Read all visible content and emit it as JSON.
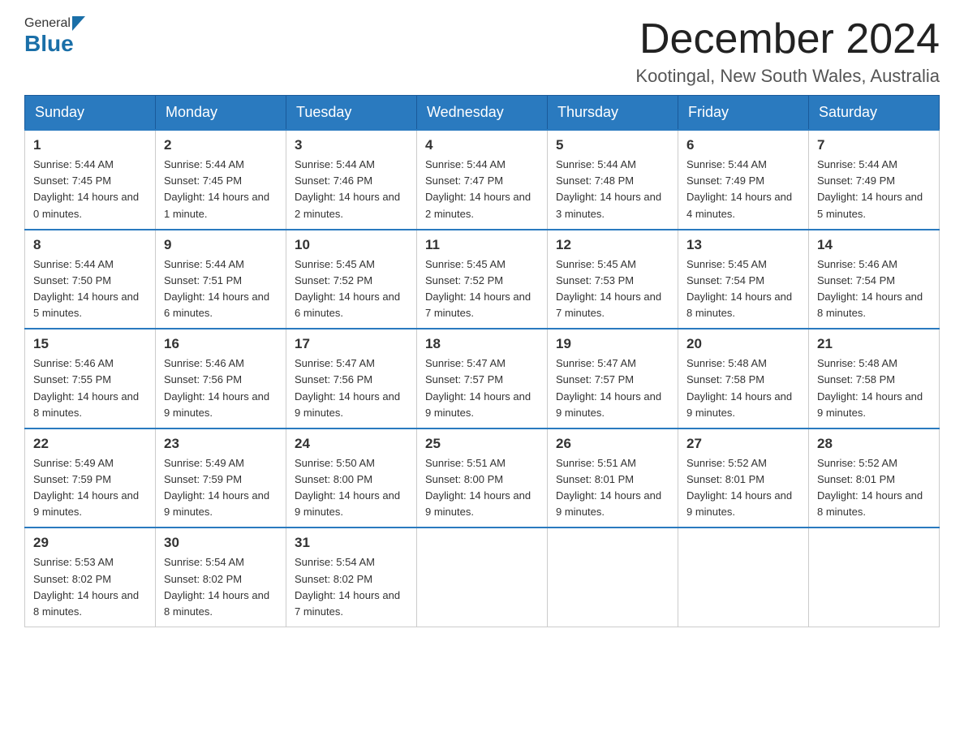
{
  "logo": {
    "general": "General",
    "blue": "Blue"
  },
  "title": "December 2024",
  "location": "Kootingal, New South Wales, Australia",
  "days_of_week": [
    "Sunday",
    "Monday",
    "Tuesday",
    "Wednesday",
    "Thursday",
    "Friday",
    "Saturday"
  ],
  "weeks": [
    [
      {
        "day": 1,
        "sunrise": "5:44 AM",
        "sunset": "7:45 PM",
        "daylight": "14 hours and 0 minutes."
      },
      {
        "day": 2,
        "sunrise": "5:44 AM",
        "sunset": "7:45 PM",
        "daylight": "14 hours and 1 minute."
      },
      {
        "day": 3,
        "sunrise": "5:44 AM",
        "sunset": "7:46 PM",
        "daylight": "14 hours and 2 minutes."
      },
      {
        "day": 4,
        "sunrise": "5:44 AM",
        "sunset": "7:47 PM",
        "daylight": "14 hours and 2 minutes."
      },
      {
        "day": 5,
        "sunrise": "5:44 AM",
        "sunset": "7:48 PM",
        "daylight": "14 hours and 3 minutes."
      },
      {
        "day": 6,
        "sunrise": "5:44 AM",
        "sunset": "7:49 PM",
        "daylight": "14 hours and 4 minutes."
      },
      {
        "day": 7,
        "sunrise": "5:44 AM",
        "sunset": "7:49 PM",
        "daylight": "14 hours and 5 minutes."
      }
    ],
    [
      {
        "day": 8,
        "sunrise": "5:44 AM",
        "sunset": "7:50 PM",
        "daylight": "14 hours and 5 minutes."
      },
      {
        "day": 9,
        "sunrise": "5:44 AM",
        "sunset": "7:51 PM",
        "daylight": "14 hours and 6 minutes."
      },
      {
        "day": 10,
        "sunrise": "5:45 AM",
        "sunset": "7:52 PM",
        "daylight": "14 hours and 6 minutes."
      },
      {
        "day": 11,
        "sunrise": "5:45 AM",
        "sunset": "7:52 PM",
        "daylight": "14 hours and 7 minutes."
      },
      {
        "day": 12,
        "sunrise": "5:45 AM",
        "sunset": "7:53 PM",
        "daylight": "14 hours and 7 minutes."
      },
      {
        "day": 13,
        "sunrise": "5:45 AM",
        "sunset": "7:54 PM",
        "daylight": "14 hours and 8 minutes."
      },
      {
        "day": 14,
        "sunrise": "5:46 AM",
        "sunset": "7:54 PM",
        "daylight": "14 hours and 8 minutes."
      }
    ],
    [
      {
        "day": 15,
        "sunrise": "5:46 AM",
        "sunset": "7:55 PM",
        "daylight": "14 hours and 8 minutes."
      },
      {
        "day": 16,
        "sunrise": "5:46 AM",
        "sunset": "7:56 PM",
        "daylight": "14 hours and 9 minutes."
      },
      {
        "day": 17,
        "sunrise": "5:47 AM",
        "sunset": "7:56 PM",
        "daylight": "14 hours and 9 minutes."
      },
      {
        "day": 18,
        "sunrise": "5:47 AM",
        "sunset": "7:57 PM",
        "daylight": "14 hours and 9 minutes."
      },
      {
        "day": 19,
        "sunrise": "5:47 AM",
        "sunset": "7:57 PM",
        "daylight": "14 hours and 9 minutes."
      },
      {
        "day": 20,
        "sunrise": "5:48 AM",
        "sunset": "7:58 PM",
        "daylight": "14 hours and 9 minutes."
      },
      {
        "day": 21,
        "sunrise": "5:48 AM",
        "sunset": "7:58 PM",
        "daylight": "14 hours and 9 minutes."
      }
    ],
    [
      {
        "day": 22,
        "sunrise": "5:49 AM",
        "sunset": "7:59 PM",
        "daylight": "14 hours and 9 minutes."
      },
      {
        "day": 23,
        "sunrise": "5:49 AM",
        "sunset": "7:59 PM",
        "daylight": "14 hours and 9 minutes."
      },
      {
        "day": 24,
        "sunrise": "5:50 AM",
        "sunset": "8:00 PM",
        "daylight": "14 hours and 9 minutes."
      },
      {
        "day": 25,
        "sunrise": "5:51 AM",
        "sunset": "8:00 PM",
        "daylight": "14 hours and 9 minutes."
      },
      {
        "day": 26,
        "sunrise": "5:51 AM",
        "sunset": "8:01 PM",
        "daylight": "14 hours and 9 minutes."
      },
      {
        "day": 27,
        "sunrise": "5:52 AM",
        "sunset": "8:01 PM",
        "daylight": "14 hours and 9 minutes."
      },
      {
        "day": 28,
        "sunrise": "5:52 AM",
        "sunset": "8:01 PM",
        "daylight": "14 hours and 8 minutes."
      }
    ],
    [
      {
        "day": 29,
        "sunrise": "5:53 AM",
        "sunset": "8:02 PM",
        "daylight": "14 hours and 8 minutes."
      },
      {
        "day": 30,
        "sunrise": "5:54 AM",
        "sunset": "8:02 PM",
        "daylight": "14 hours and 8 minutes."
      },
      {
        "day": 31,
        "sunrise": "5:54 AM",
        "sunset": "8:02 PM",
        "daylight": "14 hours and 7 minutes."
      },
      null,
      null,
      null,
      null
    ]
  ]
}
